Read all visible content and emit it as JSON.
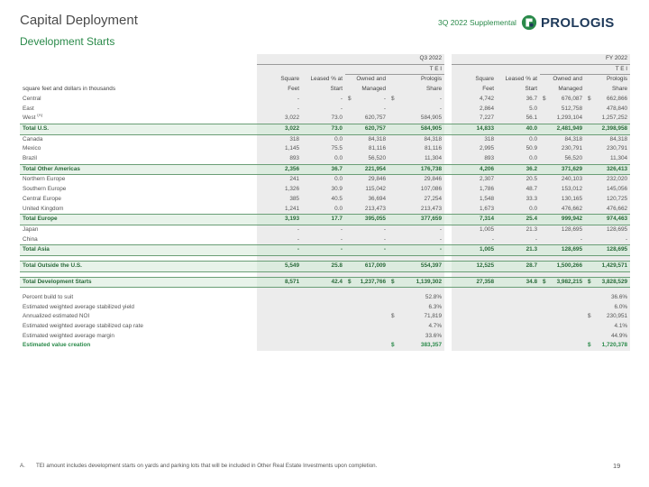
{
  "header": {
    "title": "Capital Deployment",
    "subtitle": "Development Starts",
    "supplement": "3Q 2022 Supplemental",
    "logo_text": "PROLOGIS",
    "brand_green": "#2a8a4a",
    "brand_navy": "#1f3a5a"
  },
  "table": {
    "periods": {
      "q3": "Q3 2022",
      "fy": "FY 2022"
    },
    "tei": "T E I",
    "units_label": "square feet and dollars in thousands",
    "cols": [
      {
        "line1": "Square",
        "line2": "Feet"
      },
      {
        "line1": "Leased % at",
        "line2": "Start"
      },
      {
        "line1": "Owned and",
        "line2": "Managed"
      },
      {
        "line1": "Prologis",
        "line2": "Share"
      }
    ],
    "rows": [
      {
        "label": "Central",
        "sup": "",
        "type": "item",
        "v": [
          "-",
          "-",
          "-",
          "-",
          "4,742",
          "36.7",
          "676,087",
          "662,866"
        ],
        "d": [
          "",
          "",
          "$",
          "$",
          "",
          "",
          "$",
          "$"
        ]
      },
      {
        "label": "East",
        "sup": "",
        "type": "item",
        "v": [
          "-",
          "-",
          "-",
          "-",
          "2,864",
          "5.0",
          "512,758",
          "478,840"
        ],
        "d": [
          "",
          "",
          "",
          "",
          "",
          "",
          "",
          ""
        ]
      },
      {
        "label": "West",
        "sup": "(A)",
        "type": "item",
        "v": [
          "3,022",
          "73.0",
          "620,757",
          "584,905",
          "7,227",
          "56.1",
          "1,293,104",
          "1,257,252"
        ],
        "d": [
          "",
          "",
          "",
          "",
          "",
          "",
          "",
          ""
        ]
      },
      {
        "label": "Total U.S.",
        "sup": "",
        "type": "group",
        "v": [
          "3,022",
          "73.0",
          "620,757",
          "584,905",
          "14,833",
          "40.0",
          "2,481,949",
          "2,398,958"
        ],
        "d": [
          "",
          "",
          "",
          "",
          "",
          "",
          "",
          ""
        ]
      },
      {
        "label": "Canada",
        "sup": "",
        "type": "item",
        "v": [
          "318",
          "0.0",
          "84,318",
          "84,318",
          "318",
          "0.0",
          "84,318",
          "84,318"
        ],
        "d": [
          "",
          "",
          "",
          "",
          "",
          "",
          "",
          ""
        ]
      },
      {
        "label": "Mexico",
        "sup": "",
        "type": "item",
        "v": [
          "1,145",
          "75.5",
          "81,116",
          "81,116",
          "2,995",
          "50.9",
          "230,791",
          "230,791"
        ],
        "d": [
          "",
          "",
          "",
          "",
          "",
          "",
          "",
          ""
        ]
      },
      {
        "label": "Brazil",
        "sup": "",
        "type": "item",
        "v": [
          "893",
          "0.0",
          "56,520",
          "11,304",
          "893",
          "0.0",
          "56,520",
          "11,304"
        ],
        "d": [
          "",
          "",
          "",
          "",
          "",
          "",
          "",
          ""
        ]
      },
      {
        "label": "Total Other Americas",
        "sup": "",
        "type": "group",
        "v": [
          "2,356",
          "36.7",
          "221,954",
          "176,738",
          "4,206",
          "36.2",
          "371,629",
          "326,413"
        ],
        "d": [
          "",
          "",
          "",
          "",
          "",
          "",
          "",
          ""
        ]
      },
      {
        "label": "Northern Europe",
        "sup": "",
        "type": "item",
        "v": [
          "241",
          "0.0",
          "29,846",
          "29,846",
          "2,307",
          "20.5",
          "240,103",
          "232,020"
        ],
        "d": [
          "",
          "",
          "",
          "",
          "",
          "",
          "",
          ""
        ]
      },
      {
        "label": "Southern Europe",
        "sup": "",
        "type": "item",
        "v": [
          "1,326",
          "30.9",
          "115,042",
          "107,086",
          "1,786",
          "48.7",
          "153,012",
          "145,056"
        ],
        "d": [
          "",
          "",
          "",
          "",
          "",
          "",
          "",
          ""
        ]
      },
      {
        "label": "Central Europe",
        "sup": "",
        "type": "item",
        "v": [
          "385",
          "40.5",
          "36,694",
          "27,254",
          "1,548",
          "33.3",
          "130,165",
          "120,725"
        ],
        "d": [
          "",
          "",
          "",
          "",
          "",
          "",
          "",
          ""
        ]
      },
      {
        "label": "United Kingdom",
        "sup": "",
        "type": "item",
        "v": [
          "1,241",
          "0.0",
          "213,473",
          "213,473",
          "1,673",
          "0.0",
          "476,662",
          "476,662"
        ],
        "d": [
          "",
          "",
          "",
          "",
          "",
          "",
          "",
          ""
        ]
      },
      {
        "label": "Total Europe",
        "sup": "",
        "type": "group",
        "v": [
          "3,193",
          "17.7",
          "395,055",
          "377,659",
          "7,314",
          "25.4",
          "999,942",
          "974,463"
        ],
        "d": [
          "",
          "",
          "",
          "",
          "",
          "",
          "",
          ""
        ]
      },
      {
        "label": "Japan",
        "sup": "",
        "type": "item",
        "v": [
          "-",
          "-",
          "-",
          "-",
          "1,005",
          "21.3",
          "128,695",
          "128,695"
        ],
        "d": [
          "",
          "",
          "",
          "",
          "",
          "",
          "",
          ""
        ]
      },
      {
        "label": "China",
        "sup": "",
        "type": "item",
        "v": [
          "-",
          "-",
          "-",
          "-",
          "-",
          "-",
          "-",
          "-"
        ],
        "d": [
          "",
          "",
          "",
          "",
          "",
          "",
          "",
          ""
        ]
      },
      {
        "label": "Total Asia",
        "sup": "",
        "type": "group",
        "v": [
          "-",
          "-",
          "-",
          "-",
          "1,005",
          "21.3",
          "128,695",
          "128,695"
        ],
        "d": [
          "",
          "",
          "",
          "",
          "",
          "",
          "",
          ""
        ]
      },
      {
        "type": "spacer"
      },
      {
        "label": "Total Outside the U.S.",
        "sup": "",
        "type": "group",
        "v": [
          "5,549",
          "25.8",
          "617,009",
          "554,397",
          "12,525",
          "28.7",
          "1,500,266",
          "1,429,571"
        ],
        "d": [
          "",
          "",
          "",
          "",
          "",
          "",
          "",
          ""
        ]
      },
      {
        "type": "spacer"
      },
      {
        "label": "Total Development Starts",
        "sup": "",
        "type": "group",
        "v": [
          "8,571",
          "42.4",
          "1,237,766",
          "1,139,302",
          "27,358",
          "34.8",
          "3,982,215",
          "3,828,529"
        ],
        "d": [
          "",
          "",
          "$",
          "$",
          "",
          "",
          "$",
          "$"
        ]
      },
      {
        "type": "spacer"
      },
      {
        "label": "Percent build to suit",
        "sup": "",
        "type": "metric",
        "v": [
          "",
          "",
          "",
          "52.8%",
          "",
          "",
          "",
          "36.6%"
        ],
        "d": [
          "",
          "",
          "",
          "",
          "",
          "",
          "",
          ""
        ]
      },
      {
        "label": "Estimated weighted average stabilized yield",
        "sup": "",
        "type": "metric",
        "v": [
          "",
          "",
          "",
          "6.3%",
          "",
          "",
          "",
          "6.0%"
        ],
        "d": [
          "",
          "",
          "",
          "",
          "",
          "",
          "",
          ""
        ]
      },
      {
        "label": "Annualized estimated NOI",
        "sup": "",
        "type": "metric",
        "v": [
          "",
          "",
          "",
          "71,819",
          "",
          "",
          "",
          "230,951"
        ],
        "d": [
          "",
          "",
          "",
          "$",
          "",
          "",
          "",
          "$"
        ]
      },
      {
        "label": "Estimated weighted average stabilized cap rate",
        "sup": "",
        "type": "metric",
        "v": [
          "",
          "",
          "",
          "4.7%",
          "",
          "",
          "",
          "4.1%"
        ],
        "d": [
          "",
          "",
          "",
          "",
          "",
          "",
          "",
          ""
        ]
      },
      {
        "label": "Estimated weighted average margin",
        "sup": "",
        "type": "metric",
        "v": [
          "",
          "",
          "",
          "33.6%",
          "",
          "",
          "",
          "44.9%"
        ],
        "d": [
          "",
          "",
          "",
          "",
          "",
          "",
          "",
          ""
        ]
      },
      {
        "label": "Estimated value creation",
        "sup": "",
        "type": "highlight",
        "v": [
          "",
          "",
          "",
          "383,357",
          "",
          "",
          "",
          "1,720,378"
        ],
        "d": [
          "",
          "",
          "",
          "$",
          "",
          "",
          "",
          "$"
        ]
      }
    ]
  },
  "footnote": {
    "mark": "A.",
    "text": "TEI amount includes development starts on yards and parking lots that will be included in Other Real Estate Investments upon completion."
  },
  "page_number": "19"
}
